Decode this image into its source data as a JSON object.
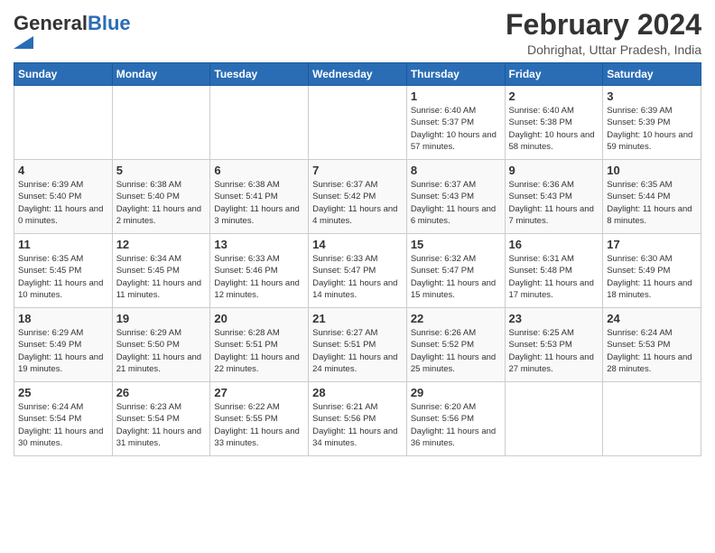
{
  "logo": {
    "general": "General",
    "blue": "Blue"
  },
  "header": {
    "month_year": "February 2024",
    "location": "Dohrighat, Uttar Pradesh, India"
  },
  "days_of_week": [
    "Sunday",
    "Monday",
    "Tuesday",
    "Wednesday",
    "Thursday",
    "Friday",
    "Saturday"
  ],
  "weeks": [
    [
      {
        "day": "",
        "info": ""
      },
      {
        "day": "",
        "info": ""
      },
      {
        "day": "",
        "info": ""
      },
      {
        "day": "",
        "info": ""
      },
      {
        "day": "1",
        "info": "Sunrise: 6:40 AM\nSunset: 5:37 PM\nDaylight: 10 hours and 57 minutes."
      },
      {
        "day": "2",
        "info": "Sunrise: 6:40 AM\nSunset: 5:38 PM\nDaylight: 10 hours and 58 minutes."
      },
      {
        "day": "3",
        "info": "Sunrise: 6:39 AM\nSunset: 5:39 PM\nDaylight: 10 hours and 59 minutes."
      }
    ],
    [
      {
        "day": "4",
        "info": "Sunrise: 6:39 AM\nSunset: 5:40 PM\nDaylight: 11 hours and 0 minutes."
      },
      {
        "day": "5",
        "info": "Sunrise: 6:38 AM\nSunset: 5:40 PM\nDaylight: 11 hours and 2 minutes."
      },
      {
        "day": "6",
        "info": "Sunrise: 6:38 AM\nSunset: 5:41 PM\nDaylight: 11 hours and 3 minutes."
      },
      {
        "day": "7",
        "info": "Sunrise: 6:37 AM\nSunset: 5:42 PM\nDaylight: 11 hours and 4 minutes."
      },
      {
        "day": "8",
        "info": "Sunrise: 6:37 AM\nSunset: 5:43 PM\nDaylight: 11 hours and 6 minutes."
      },
      {
        "day": "9",
        "info": "Sunrise: 6:36 AM\nSunset: 5:43 PM\nDaylight: 11 hours and 7 minutes."
      },
      {
        "day": "10",
        "info": "Sunrise: 6:35 AM\nSunset: 5:44 PM\nDaylight: 11 hours and 8 minutes."
      }
    ],
    [
      {
        "day": "11",
        "info": "Sunrise: 6:35 AM\nSunset: 5:45 PM\nDaylight: 11 hours and 10 minutes."
      },
      {
        "day": "12",
        "info": "Sunrise: 6:34 AM\nSunset: 5:45 PM\nDaylight: 11 hours and 11 minutes."
      },
      {
        "day": "13",
        "info": "Sunrise: 6:33 AM\nSunset: 5:46 PM\nDaylight: 11 hours and 12 minutes."
      },
      {
        "day": "14",
        "info": "Sunrise: 6:33 AM\nSunset: 5:47 PM\nDaylight: 11 hours and 14 minutes."
      },
      {
        "day": "15",
        "info": "Sunrise: 6:32 AM\nSunset: 5:47 PM\nDaylight: 11 hours and 15 minutes."
      },
      {
        "day": "16",
        "info": "Sunrise: 6:31 AM\nSunset: 5:48 PM\nDaylight: 11 hours and 17 minutes."
      },
      {
        "day": "17",
        "info": "Sunrise: 6:30 AM\nSunset: 5:49 PM\nDaylight: 11 hours and 18 minutes."
      }
    ],
    [
      {
        "day": "18",
        "info": "Sunrise: 6:29 AM\nSunset: 5:49 PM\nDaylight: 11 hours and 19 minutes."
      },
      {
        "day": "19",
        "info": "Sunrise: 6:29 AM\nSunset: 5:50 PM\nDaylight: 11 hours and 21 minutes."
      },
      {
        "day": "20",
        "info": "Sunrise: 6:28 AM\nSunset: 5:51 PM\nDaylight: 11 hours and 22 minutes."
      },
      {
        "day": "21",
        "info": "Sunrise: 6:27 AM\nSunset: 5:51 PM\nDaylight: 11 hours and 24 minutes."
      },
      {
        "day": "22",
        "info": "Sunrise: 6:26 AM\nSunset: 5:52 PM\nDaylight: 11 hours and 25 minutes."
      },
      {
        "day": "23",
        "info": "Sunrise: 6:25 AM\nSunset: 5:53 PM\nDaylight: 11 hours and 27 minutes."
      },
      {
        "day": "24",
        "info": "Sunrise: 6:24 AM\nSunset: 5:53 PM\nDaylight: 11 hours and 28 minutes."
      }
    ],
    [
      {
        "day": "25",
        "info": "Sunrise: 6:24 AM\nSunset: 5:54 PM\nDaylight: 11 hours and 30 minutes."
      },
      {
        "day": "26",
        "info": "Sunrise: 6:23 AM\nSunset: 5:54 PM\nDaylight: 11 hours and 31 minutes."
      },
      {
        "day": "27",
        "info": "Sunrise: 6:22 AM\nSunset: 5:55 PM\nDaylight: 11 hours and 33 minutes."
      },
      {
        "day": "28",
        "info": "Sunrise: 6:21 AM\nSunset: 5:56 PM\nDaylight: 11 hours and 34 minutes."
      },
      {
        "day": "29",
        "info": "Sunrise: 6:20 AM\nSunset: 5:56 PM\nDaylight: 11 hours and 36 minutes."
      },
      {
        "day": "",
        "info": ""
      },
      {
        "day": "",
        "info": ""
      }
    ]
  ]
}
